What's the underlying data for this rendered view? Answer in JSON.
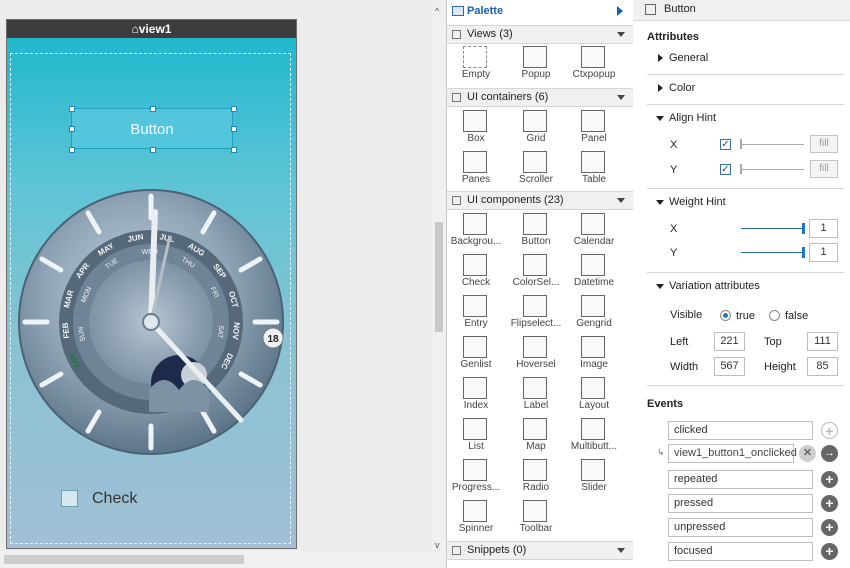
{
  "canvas": {
    "view_title": "view1",
    "button_label": "Button",
    "check_label": "Check",
    "watch": {
      "months": [
        "JAN",
        "FEB",
        "MAR",
        "APR",
        "MAY",
        "JUN",
        "JUL",
        "AUG",
        "SEP",
        "OCT",
        "NOV",
        "DEC"
      ],
      "days": [
        "SUN",
        "MON",
        "TUE",
        "WED",
        "THU",
        "FRI",
        "SAT"
      ],
      "date": "18",
      "highlighted_month": "JAN"
    }
  },
  "palette": {
    "title": "Palette",
    "sections": [
      {
        "title": "Views (3)",
        "items": [
          "Empty",
          "Popup",
          "Ctxpopup"
        ]
      },
      {
        "title": "UI containers (6)",
        "items": [
          "Box",
          "Grid",
          "Panel",
          "Panes",
          "Scroller",
          "Table"
        ]
      },
      {
        "title": "UI components (23)",
        "items": [
          "Backgrou...",
          "Button",
          "Calendar",
          "Check",
          "ColorSel...",
          "Datetime",
          "Entry",
          "Flipselect...",
          "Gengrid",
          "Genlist",
          "Hoversel",
          "Image",
          "Index",
          "Label",
          "Layout",
          "List",
          "Map",
          "Multibutt...",
          "Progress...",
          "Radio",
          "Slider",
          "Spinner",
          "Toolbar"
        ]
      },
      {
        "title": "Snippets (0)",
        "items": []
      }
    ]
  },
  "properties": {
    "header": "Button",
    "attributes_title": "Attributes",
    "general": "General",
    "color": "Color",
    "align_hint": {
      "title": "Align Hint",
      "x_label": "X",
      "y_label": "Y",
      "fill_label": "fill",
      "x_checked": true,
      "y_checked": true
    },
    "weight_hint": {
      "title": "Weight Hint",
      "x_label": "X",
      "y_label": "Y",
      "x_value": "1",
      "y_value": "1"
    },
    "variation": {
      "title": "Variation attributes",
      "visible_label": "Visible",
      "true_label": "true",
      "false_label": "false",
      "visible_value": "true",
      "left_label": "Left",
      "left_value": "221",
      "top_label": "Top",
      "top_value": "111",
      "width_label": "Width",
      "width_value": "567",
      "height_label": "Height",
      "height_value": "85"
    },
    "events_title": "Events",
    "events": [
      {
        "name": "clicked",
        "handler": "view1_button1_onclicked"
      },
      {
        "name": "repeated"
      },
      {
        "name": "pressed"
      },
      {
        "name": "unpressed"
      },
      {
        "name": "focused"
      }
    ]
  },
  "colors": {
    "accent": "#1e78c8",
    "palette_title": "#1a5fb4"
  }
}
